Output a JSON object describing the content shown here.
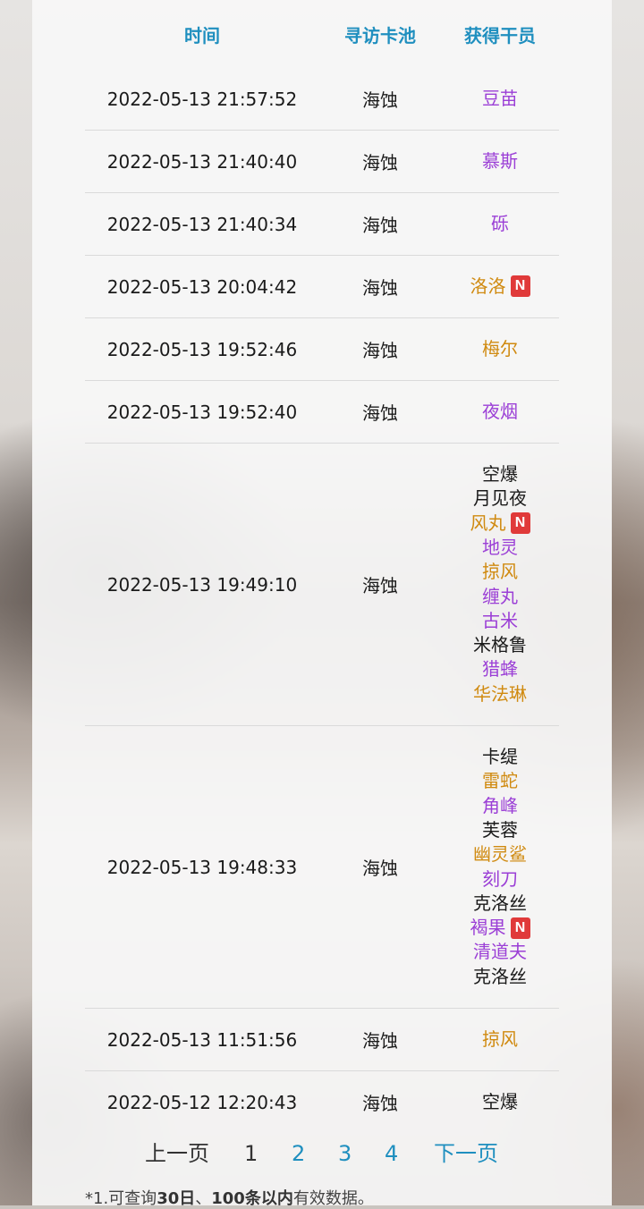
{
  "colors": {
    "header_text": "#1f8fbf",
    "op_purple": "#9b3fd6",
    "op_gold": "#d08a10",
    "op_black": "#1a1a1a",
    "new_badge": "#e03a3a",
    "link": "#1f8fbf"
  },
  "table": {
    "headers": {
      "time": "时间",
      "pool": "寻访卡池",
      "operators": "获得干员"
    },
    "rows": [
      {
        "time": "2022-05-13 21:57:52",
        "pool": "海蚀",
        "ops": [
          {
            "name": "豆苗",
            "color": "#9b3fd6",
            "new": false
          }
        ]
      },
      {
        "time": "2022-05-13 21:40:40",
        "pool": "海蚀",
        "ops": [
          {
            "name": "慕斯",
            "color": "#9b3fd6",
            "new": false
          }
        ]
      },
      {
        "time": "2022-05-13 21:40:34",
        "pool": "海蚀",
        "ops": [
          {
            "name": "砾",
            "color": "#9b3fd6",
            "new": false
          }
        ]
      },
      {
        "time": "2022-05-13 20:04:42",
        "pool": "海蚀",
        "ops": [
          {
            "name": "洛洛",
            "color": "#d08a10",
            "new": true
          }
        ]
      },
      {
        "time": "2022-05-13 19:52:46",
        "pool": "海蚀",
        "ops": [
          {
            "name": "梅尔",
            "color": "#d08a10",
            "new": false
          }
        ]
      },
      {
        "time": "2022-05-13 19:52:40",
        "pool": "海蚀",
        "ops": [
          {
            "name": "夜烟",
            "color": "#9b3fd6",
            "new": false
          }
        ]
      },
      {
        "time": "2022-05-13 19:49:10",
        "pool": "海蚀",
        "ops": [
          {
            "name": "空爆",
            "color": "#1a1a1a",
            "new": false
          },
          {
            "name": "月见夜",
            "color": "#1a1a1a",
            "new": false
          },
          {
            "name": "风丸",
            "color": "#d08a10",
            "new": true
          },
          {
            "name": "地灵",
            "color": "#9b3fd6",
            "new": false
          },
          {
            "name": "掠风",
            "color": "#d08a10",
            "new": false
          },
          {
            "name": "缠丸",
            "color": "#9b3fd6",
            "new": false
          },
          {
            "name": "古米",
            "color": "#9b3fd6",
            "new": false
          },
          {
            "name": "米格鲁",
            "color": "#1a1a1a",
            "new": false
          },
          {
            "name": "猎蜂",
            "color": "#9b3fd6",
            "new": false
          },
          {
            "name": "华法琳",
            "color": "#d08a10",
            "new": false
          }
        ]
      },
      {
        "time": "2022-05-13 19:48:33",
        "pool": "海蚀",
        "ops": [
          {
            "name": "卡缇",
            "color": "#1a1a1a",
            "new": false
          },
          {
            "name": "雷蛇",
            "color": "#d08a10",
            "new": false
          },
          {
            "name": "角峰",
            "color": "#9b3fd6",
            "new": false
          },
          {
            "name": "芙蓉",
            "color": "#1a1a1a",
            "new": false
          },
          {
            "name": "幽灵鲨",
            "color": "#d08a10",
            "new": false
          },
          {
            "name": "刻刀",
            "color": "#9b3fd6",
            "new": false
          },
          {
            "name": "克洛丝",
            "color": "#1a1a1a",
            "new": false
          },
          {
            "name": "褐果",
            "color": "#9b3fd6",
            "new": true
          },
          {
            "name": "清道夫",
            "color": "#9b3fd6",
            "new": false
          },
          {
            "name": "克洛丝",
            "color": "#1a1a1a",
            "new": false
          }
        ]
      },
      {
        "time": "2022-05-13 11:51:56",
        "pool": "海蚀",
        "ops": [
          {
            "name": "掠风",
            "color": "#d08a10",
            "new": false
          }
        ]
      },
      {
        "time": "2022-05-12 12:20:43",
        "pool": "海蚀",
        "ops": [
          {
            "name": "空爆",
            "color": "#1a1a1a",
            "new": false
          }
        ]
      }
    ],
    "new_badge_label": "N"
  },
  "pager": {
    "prev": "上一页",
    "pages": [
      "1",
      "2",
      "3",
      "4"
    ],
    "current": "1",
    "next": "下一页"
  },
  "note": {
    "prefix": "*1.可查询",
    "bold1": "30日",
    "sep": "、",
    "bold2": "100条以内",
    "suffix": "有效数据。"
  }
}
